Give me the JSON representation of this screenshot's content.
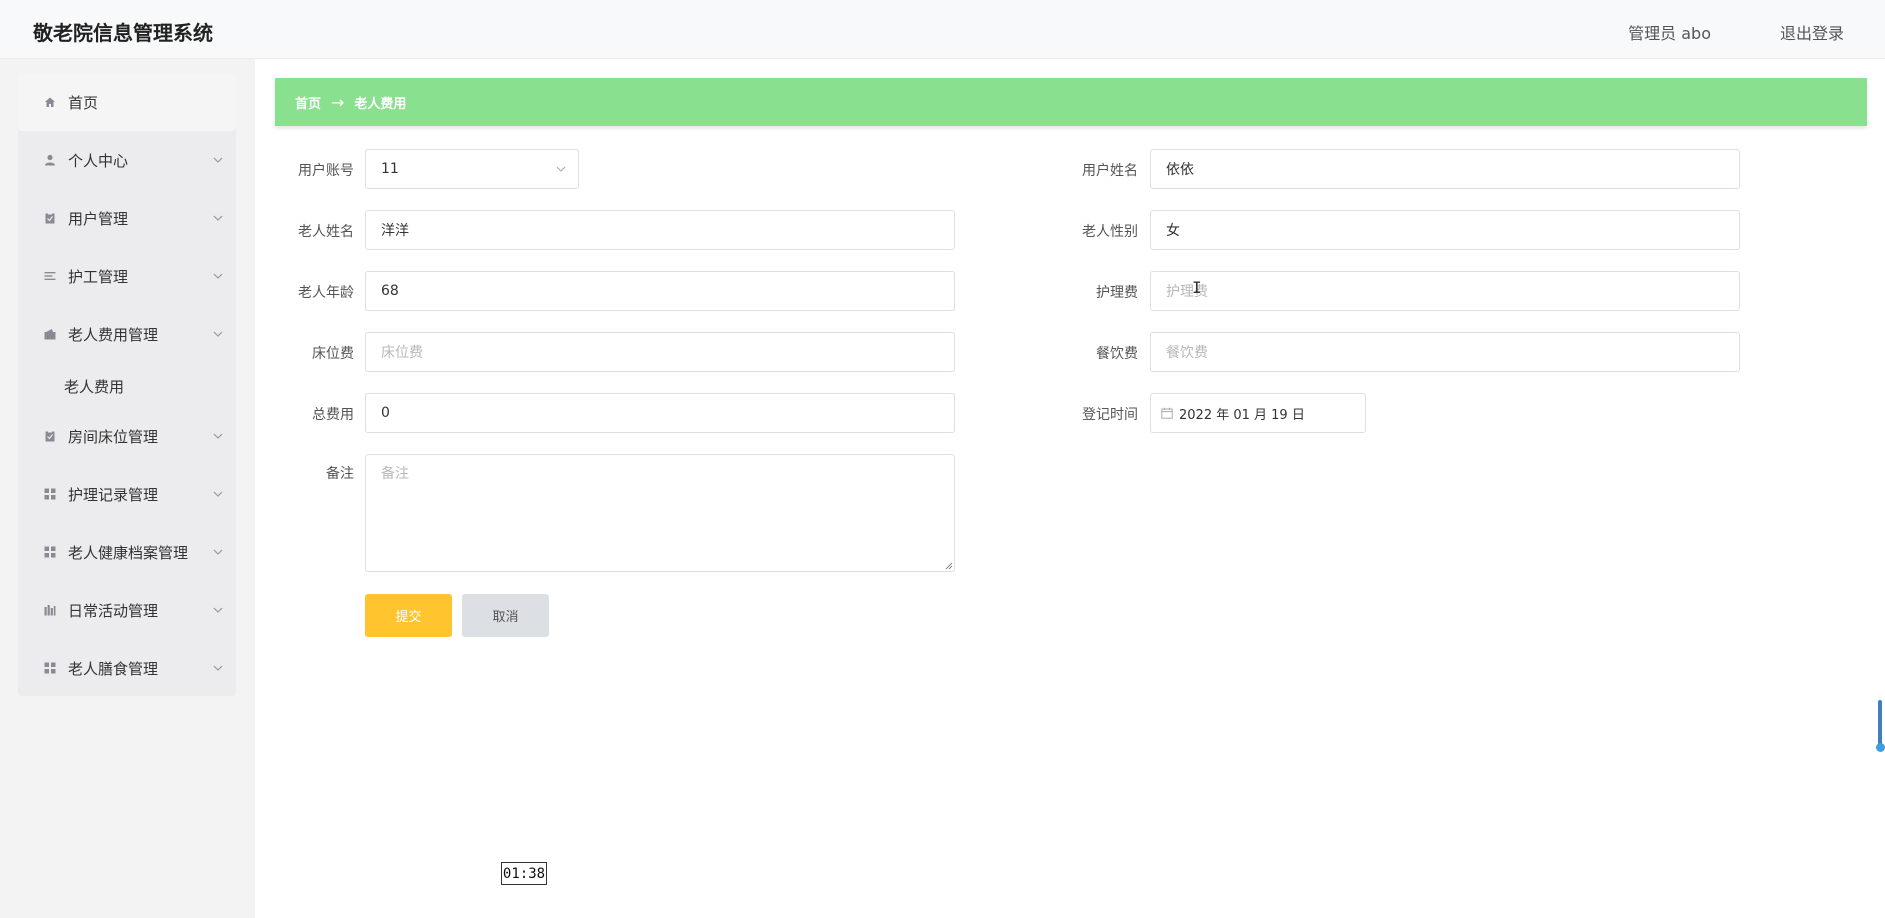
{
  "header": {
    "app_title": "敬老院信息管理系统",
    "user_label": "管理员 abo",
    "logout_label": "退出登录"
  },
  "sidebar": {
    "items": [
      {
        "label": "首页",
        "icon": "home-icon"
      },
      {
        "label": "个人中心",
        "icon": "user-icon"
      },
      {
        "label": "用户管理",
        "icon": "clipboard-icon"
      },
      {
        "label": "护工管理",
        "icon": "list-icon"
      },
      {
        "label": "老人费用管理",
        "icon": "wallet-icon"
      },
      {
        "label": "房间床位管理",
        "icon": "clipboard-icon"
      },
      {
        "label": "护理记录管理",
        "icon": "grid-icon"
      },
      {
        "label": "老人健康档案管理",
        "icon": "grid-icon"
      },
      {
        "label": "日常活动管理",
        "icon": "bar-icon"
      },
      {
        "label": "老人膳食管理",
        "icon": "grid-icon"
      }
    ],
    "sub_item": "老人费用"
  },
  "breadcrumb": {
    "home": "首页",
    "arrow": "→",
    "current": "老人费用"
  },
  "form": {
    "user_account": {
      "label": "用户账号",
      "value": "11"
    },
    "user_name": {
      "label": "用户姓名",
      "value": "依依"
    },
    "elder_name": {
      "label": "老人姓名",
      "value": "洋洋"
    },
    "elder_gender": {
      "label": "老人性别",
      "value": "女"
    },
    "elder_age": {
      "label": "老人年龄",
      "value": "68"
    },
    "nursing_fee": {
      "label": "护理费",
      "placeholder": "护理费"
    },
    "bed_fee": {
      "label": "床位费",
      "placeholder": "床位费"
    },
    "meal_fee": {
      "label": "餐饮费",
      "placeholder": "餐饮费"
    },
    "total_fee": {
      "label": "总费用",
      "value": "0"
    },
    "register_time": {
      "label": "登记时间",
      "value": "2022 年 01 月 19 日"
    },
    "remark": {
      "label": "备注",
      "placeholder": "备注"
    },
    "submit_label": "提交",
    "cancel_label": "取消"
  },
  "overlay": {
    "clock": "01:38"
  },
  "colors": {
    "breadcrumb_bg": "#89e08e",
    "submit_bg": "#ffc42e",
    "cancel_bg": "#dcdfe4"
  }
}
